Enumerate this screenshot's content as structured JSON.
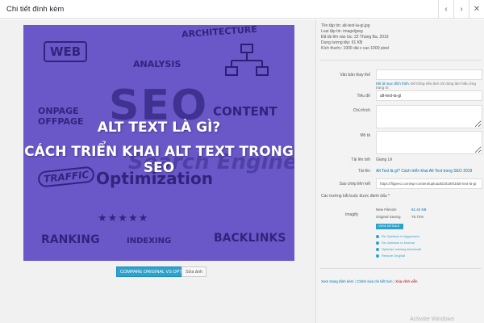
{
  "header": {
    "title": "Chi tiết đính kèm",
    "prev_icon": "‹",
    "next_icon": "›",
    "close_icon": "✕"
  },
  "image": {
    "title_line1": "ALT TEXT LÀ GÌ?",
    "title_line2": "CÁCH TRIỂN KHAI ALT TEXT TRONG SEO",
    "doodles": {
      "web": "WEB",
      "architecture": "ARCHITECTURE",
      "analysis": "ANALYSIS",
      "seo": "SEO",
      "onpage": "ONPAGE",
      "offpage": "OFFPAGE",
      "content": "CONTENT",
      "search": "Search Engine",
      "traffic": "TRAFFIC",
      "optimization": "Optimization",
      "stars": "★★★★★",
      "ranking": "RANKING",
      "indexing": "INDEXING",
      "backlinks": "BACKLINKS"
    },
    "background_color": "#6a58c9"
  },
  "actions": {
    "compare": "COMPARE ORIGINAL VS OPTIMIZED",
    "edit": "Sửa ảnh"
  },
  "details": {
    "file_name": "Tên tập tin: alt-text-la-gi.jpg",
    "file_type": "Loại tập tin: image/jpeg",
    "uploaded": "Đã tải lên vào lúc: 22 Tháng Ba, 2019",
    "size": "Dung lượng tệp: 61 KB",
    "dimensions": "Kích thước: 1900 dài x cao 1000 pixel"
  },
  "fields": {
    "alt_label": "Văn bản thay thế",
    "alt_value": "",
    "alt_help_link": "Mô tả mục đích hình",
    "alt_help_text": ". Để trống nếu ảnh chỉ dùng làm hiệu ứng trang trí.",
    "title_label": "Tiêu đề",
    "title_value": "alt-text-la-gi",
    "caption_label": "Chú thích",
    "caption_value": "",
    "description_label": "Mô tả",
    "description_value": "",
    "uploaded_by_label": "Tải lên bởi",
    "uploaded_by_value": "Giang Lê",
    "uploaded_to_label": "Tải lên",
    "uploaded_to_value": "Alt Text là gì? Cách triển khai Alt Text trong SEO 2019",
    "copy_link_label": "Sao chép liên kết",
    "copy_link_value": "https://fitgeeo.com/wp-content/uploads/2019/03/alt-text-la-gi"
  },
  "required_note": "Các trường bắt buộc được đánh dấu *",
  "imagify": {
    "label": "Imagify",
    "new_filesize_label": "New Filesize",
    "new_filesize_value": "61.44 KB",
    "original_saving_label": "Original Saving",
    "original_saving_value": "76.72%",
    "level_button": "VIEW DETAILS",
    "options": [
      "Re-Optimize to Aggressive",
      "Re-Optimize to Normal",
      "Optimize missing thumbnail",
      "Restore Original"
    ]
  },
  "bottom_links": {
    "view": "Xem trang đính kèm",
    "edit_more": "Chỉnh sửa chi tiết hơn",
    "delete": "Xóa vĩnh viễn",
    "sep": "|"
  },
  "watermark": "Activate Windows"
}
